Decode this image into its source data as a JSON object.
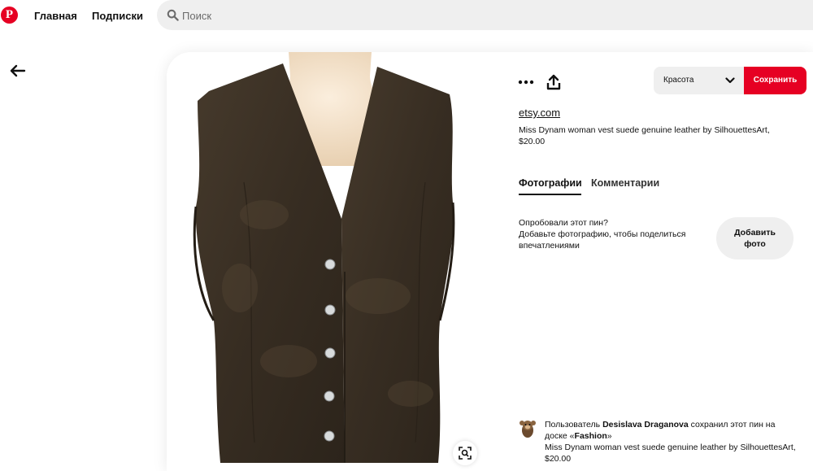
{
  "nav": {
    "logo": "P",
    "home": "Главная",
    "subscriptions": "Подписки",
    "search_placeholder": "Поиск"
  },
  "actions": {
    "board": "Красота",
    "save": "Сохранить"
  },
  "pin": {
    "domain": "etsy.com",
    "description": "Miss Dynam woman vest suede genuine leather by SilhouettesArt, $20.00"
  },
  "tabs": {
    "photos": "Фотографии",
    "comments": "Комментарии"
  },
  "try": {
    "line1": "Опробовали этот пин?",
    "line2": "Добавьте фотографию, чтобы поделиться впечатлениями",
    "button_line1": "Добавить",
    "button_line2": "фото"
  },
  "saver": {
    "prefix": "Пользователь ",
    "name": "Desislava Draganova",
    "middle": " сохранил этот пин на доске «",
    "board": "Fashion",
    "suffix": "»",
    "description": "Miss Dynam woman vest suede genuine leather by SilhouettesArt, $20.00"
  },
  "colors": {
    "brand": "#e60023",
    "vest": "#3b3226",
    "mannequin": "#f1dfc7"
  }
}
